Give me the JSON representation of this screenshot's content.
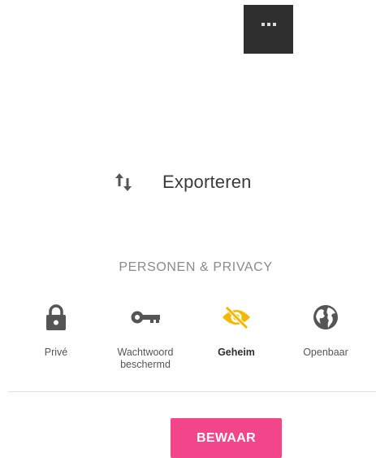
{
  "menu": {
    "more_icon": "more-horizontal-icon",
    "background": "#2f2f2f"
  },
  "export": {
    "icon": "swap-vertical-icon",
    "label": "Exporteren"
  },
  "privacy": {
    "section_title": "PERSONEN & PRIVACY",
    "selected": "geheim",
    "accent_color": "#f5b800",
    "options": [
      {
        "id": "prive",
        "icon": "lock-icon",
        "label": "Privé"
      },
      {
        "id": "wachtwoord",
        "icon": "key-icon",
        "label_line1": "Wachtwoord",
        "label_line2": "beschermd"
      },
      {
        "id": "geheim",
        "icon": "eye-off-icon",
        "label": "Geheim"
      },
      {
        "id": "openbaar",
        "icon": "globe-icon",
        "label": "Openbaar"
      }
    ]
  },
  "actions": {
    "save_label": "BEWAAR",
    "save_color": "#f2458a"
  }
}
